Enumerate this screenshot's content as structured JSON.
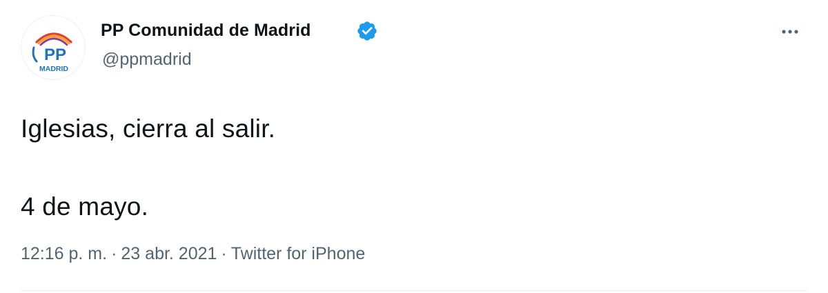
{
  "account": {
    "display_name": "PP Comunidad de Madrid",
    "handle": "@ppmadrid",
    "verified": true,
    "avatar": {
      "logo_text": "PP",
      "region_text": "MADRID",
      "colors": {
        "pp": "#1c75bc",
        "madrid": "#1c75bc",
        "arc_red": "#e63b2e",
        "arc_orange": "#f7a21b",
        "arc_purple": "#8e3a96"
      }
    }
  },
  "tweet": {
    "line_1": "Iglesias, cierra al salir.",
    "line_2": "4 de mayo."
  },
  "meta": {
    "time": "12:16 p. m.",
    "date": "23 abr. 2021",
    "source": "Twitter for iPhone",
    "separator": "·"
  },
  "icons": {
    "verified": "verified-badge-icon",
    "more": "more-options-icon"
  },
  "colors": {
    "text": "#0f1419",
    "secondary": "#536471",
    "verified_blue": "#1d9bf0",
    "divider": "#e6ecf0"
  }
}
